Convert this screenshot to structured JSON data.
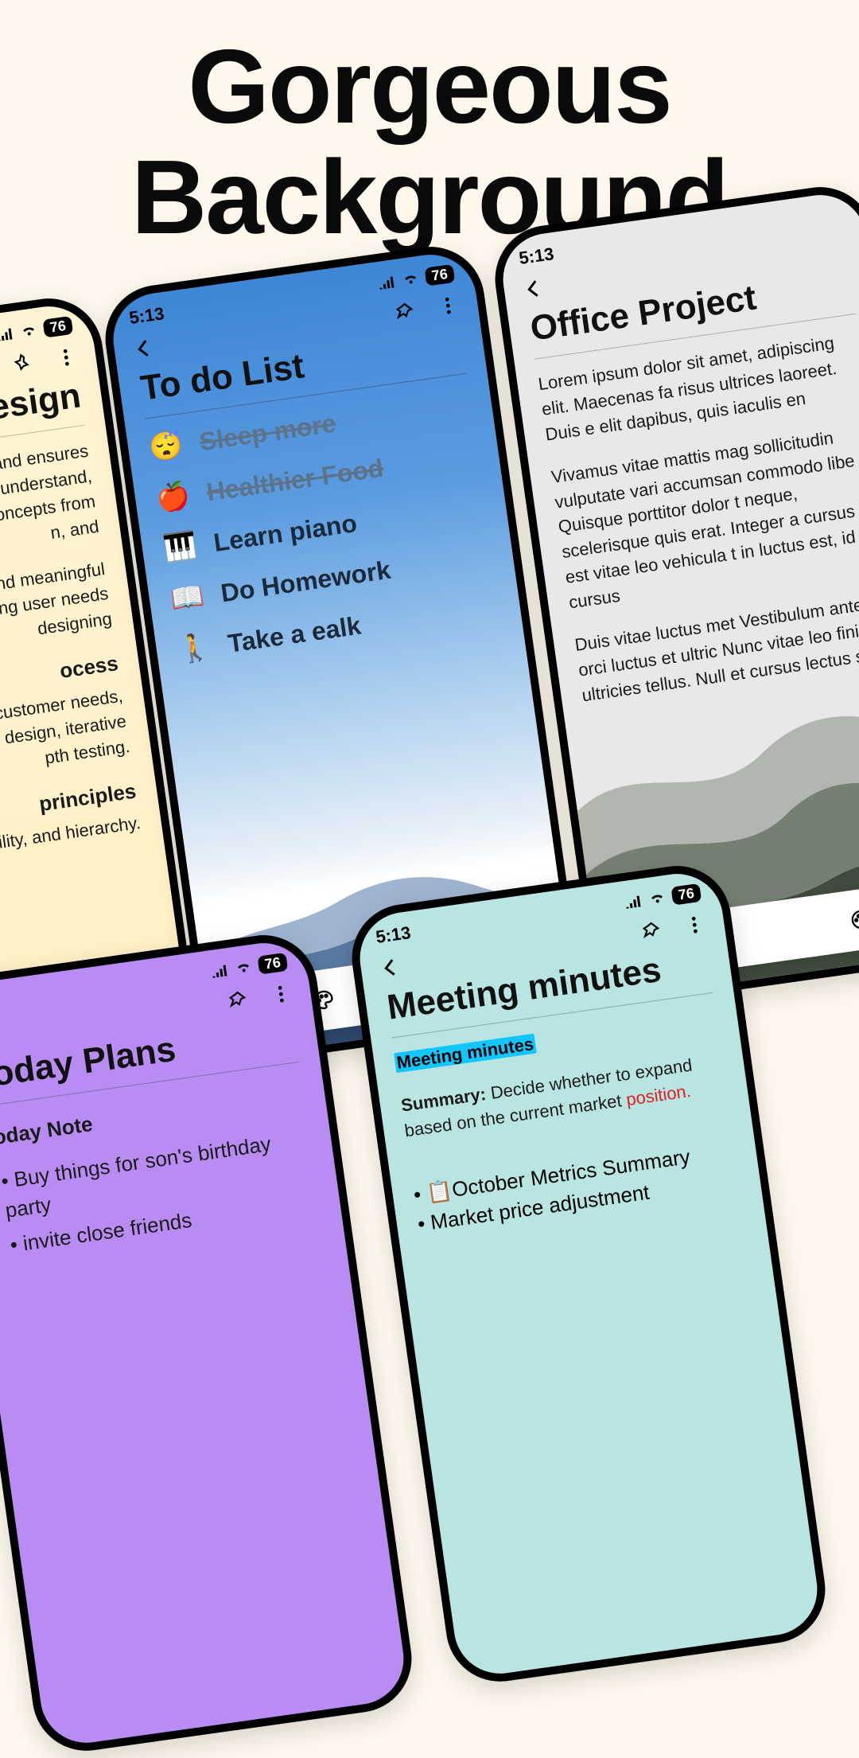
{
  "headline": {
    "line1": "Gorgeous",
    "line2": "Background"
  },
  "status": {
    "time": "5:13",
    "battery": "76"
  },
  "center": {
    "title": "To do List",
    "items": [
      {
        "emoji": "😴",
        "label": "Sleep more",
        "done": true
      },
      {
        "emoji": "🍎",
        "label": "Healthier Food",
        "done": true
      },
      {
        "emoji": "🎹",
        "label": "Learn piano",
        "done": false
      },
      {
        "emoji": "📖",
        "label": "Do Homework",
        "done": false
      },
      {
        "emoji": "🚶",
        "label": "Take a ealk",
        "done": false
      }
    ]
  },
  "left": {
    "title_fragment": "esign",
    "para1": "o and ensures\nunderstand,\noncepts from\nn, and",
    "para2": "ess and meaningful\nanding user needs\ndesigning",
    "h2": "ocess",
    "para3": "customer needs,\nred design, iterative\npth testing.",
    "h3": "principles",
    "para4": "sibility, and hierarchy."
  },
  "right": {
    "title": "Office Project",
    "para1": "Lorem ipsum dolor sit amet, adipiscing elit. Maecenas fa risus ultrices laoreet. Duis e elit dapibus, quis iaculis en",
    "para2": "Vivamus vitae mattis mag sollicitudin vulputate vari accumsan commodo libe Quisque porttitor dolor t neque, scelerisque quis erat. Integer a cursus l est vitae leo vehicula t in luctus est, id cursus",
    "para3": "Duis vitae luctus met Vestibulum ante ips orci luctus et ultric Nunc vitae leo finib ultricies tellus. Null et cursus lectus su"
  },
  "bleft": {
    "title": "Today Plans",
    "h1": "Today Note",
    "b1": "Buy things for son's birthday party",
    "b2": "invite close friends"
  },
  "bright": {
    "title": "Meeting minutes",
    "subtitle": "Meeting minutes",
    "summary_label": "Summary:",
    "summary_text": " Decide whether to expand based on the current market ",
    "summary_red": "position.",
    "bullets": [
      "📋October Metrics Summary",
      "Market price adjustment"
    ]
  },
  "toolbar_icons": [
    "text",
    "palette",
    "mic",
    "emoji",
    "draw"
  ]
}
